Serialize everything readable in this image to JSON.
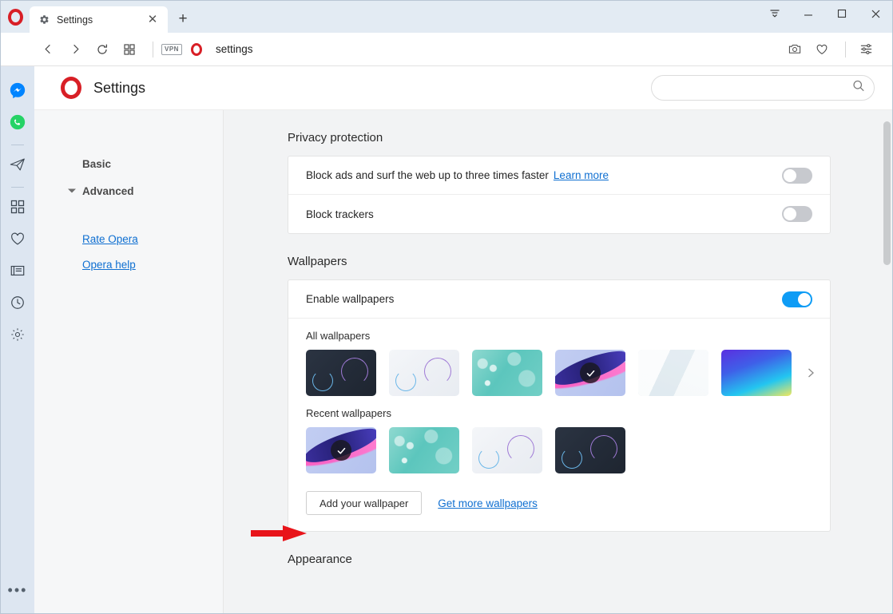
{
  "window": {
    "controls": [
      {
        "name": "tab-menu-button",
        "glyph": "menu"
      },
      {
        "name": "minimize-button",
        "glyph": "minimize"
      },
      {
        "name": "maximize-button",
        "glyph": "maximize"
      },
      {
        "name": "close-button",
        "glyph": "close"
      }
    ]
  },
  "tabs": [
    {
      "title": "Settings",
      "favicon": "gear-icon",
      "close_label": "✕"
    }
  ],
  "new_tab_label": "+",
  "navbar": {
    "back_icon": "back-arrow-icon",
    "forward_icon": "forward-arrow-icon",
    "reload_icon": "reload-icon",
    "tabs_overview_icon": "grid-icon",
    "vpn_badge": "VPN",
    "address_value": "settings",
    "right_icons": [
      "snapshot-icon",
      "heart-icon",
      "easy-setup-icon"
    ]
  },
  "rail": {
    "items": [
      {
        "name": "messenger-icon",
        "label": "Messenger"
      },
      {
        "name": "whatsapp-icon",
        "label": "WhatsApp"
      },
      {
        "name": "telegram-icon",
        "label": "Telegram"
      },
      {
        "name": "apps-grid-icon",
        "label": "Extensions"
      },
      {
        "name": "heart-icon",
        "label": "Bookmarks"
      },
      {
        "name": "news-icon",
        "label": "News"
      },
      {
        "name": "history-clock-icon",
        "label": "History"
      },
      {
        "name": "gear-icon",
        "label": "Settings"
      }
    ],
    "more_label": "•••"
  },
  "header": {
    "logo": "opera-logo-icon",
    "title": "Settings",
    "search": {
      "value": "",
      "placeholder": "",
      "icon": "search-icon"
    }
  },
  "settings_nav": {
    "items": [
      {
        "label": "Basic",
        "expandable": false
      },
      {
        "label": "Advanced",
        "expandable": true
      }
    ],
    "links": [
      {
        "label": "Rate Opera"
      },
      {
        "label": "Opera help"
      }
    ]
  },
  "sections": {
    "privacy": {
      "title": "Privacy protection",
      "rows": [
        {
          "label": "Block ads and surf the web up to three times faster",
          "link": "Learn more",
          "toggle": "off"
        },
        {
          "label": "Block trackers",
          "link": "",
          "toggle": "off"
        }
      ]
    },
    "wallpapers": {
      "title": "Wallpapers",
      "enable_label": "Enable wallpapers",
      "enable_toggle": "on",
      "all_label": "All wallpapers",
      "recent_label": "Recent wallpapers",
      "all_items": [
        {
          "name": "wallpaper-dark",
          "selected": false
        },
        {
          "name": "wallpaper-light",
          "selected": false
        },
        {
          "name": "wallpaper-teal",
          "selected": false
        },
        {
          "name": "wallpaper-pink-swirl",
          "selected": true
        },
        {
          "name": "wallpaper-pale-poly",
          "selected": false
        },
        {
          "name": "wallpaper-blue-gradient",
          "selected": false
        }
      ],
      "recent_items": [
        {
          "name": "wallpaper-pink-swirl",
          "selected": true
        },
        {
          "name": "wallpaper-teal",
          "selected": false
        },
        {
          "name": "wallpaper-light",
          "selected": false
        },
        {
          "name": "wallpaper-dark",
          "selected": false
        }
      ],
      "next_arrow": "chevron-right-icon",
      "add_button": "Add your wallpaper",
      "get_more_link": "Get more wallpapers"
    },
    "appearance": {
      "title": "Appearance"
    }
  },
  "colors": {
    "accent_blue": "#0e9cf5",
    "link_blue": "#0f6fd1",
    "opera_red": "#d81f26",
    "annotation_red": "#e8141a",
    "rail_bg": "#dde6f1",
    "pane_bg": "#f2f3f4"
  },
  "annotation": {
    "arrow": "red-arrow-pointing-at-add-your-wallpaper"
  }
}
